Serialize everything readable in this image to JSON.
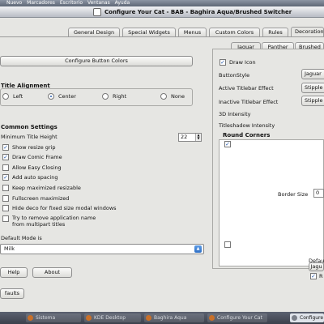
{
  "menubar": {
    "items": [
      "Nuevo",
      "Marcadores",
      "Escritorio",
      "Ventanas",
      "Ayuda"
    ]
  },
  "window": {
    "title": "Configure Your Cat - BAB - Baghira Aqua/Brushed Switcher"
  },
  "tabs": [
    {
      "label": "General Design"
    },
    {
      "label": "Special Widgets"
    },
    {
      "label": "Menus"
    },
    {
      "label": "Custom Colors"
    },
    {
      "label": "Rules"
    },
    {
      "label": "Decoration"
    }
  ],
  "left": {
    "configure_button_colors": "Configure Button Colors",
    "title_alignment": {
      "heading": "Title Alignment",
      "options": [
        "Left",
        "Center",
        "Right",
        "None"
      ],
      "selected": "Center"
    },
    "common_settings": {
      "heading": "Common Settings",
      "min_title_height_label": "Minimum Title Height",
      "min_title_height_value": "22",
      "checkboxes": [
        {
          "label": "Show resize grip",
          "checked": true
        },
        {
          "label": "Draw Comic Frame",
          "checked": true
        },
        {
          "label": "Allow Easy Closing",
          "checked": false
        },
        {
          "label": "Add auto spacing",
          "checked": true
        },
        {
          "label": "Keep maximized resizable",
          "checked": false
        },
        {
          "label": "Fullscreen maximized",
          "checked": false
        },
        {
          "label": "Hide deco for fixed size modal windows",
          "checked": false
        },
        {
          "label": "Try to remove application name",
          "label2": "from multipart titles",
          "checked": false
        }
      ]
    },
    "default_mode_label": "Default Mode is",
    "default_mode_value": "Milk",
    "help_button": "Help",
    "about_button": "About",
    "defaults_button": "faults"
  },
  "right": {
    "subtabs": [
      "Jaguar",
      "Panther",
      "Brushed"
    ],
    "draw_icon": {
      "label": "Draw Icon",
      "checked": true
    },
    "button_style_label": "ButtonStyle",
    "button_style_value": "Jaguar",
    "active_titlebar_label": "Active Titlebar Effect",
    "active_titlebar_value": "Stipple",
    "inactive_titlebar_label": "Inactive Titlebar Effect",
    "inactive_titlebar_value": "Stipple",
    "intensity_3d_label": "3D Intensity",
    "titleshadow_label": "Titleshadow Intensity",
    "round_corners_heading": "Round Corners",
    "border_size_label": "Border Size",
    "border_size_value": "0",
    "default_label": "Defau",
    "jaguar_btn": "Jagu",
    "r_label": "R"
  },
  "taskbar": {
    "tasks": [
      "Sistema",
      "KDE Desktop",
      "Baghira Aqua",
      "Configure Your Cat",
      "Configure"
    ]
  }
}
